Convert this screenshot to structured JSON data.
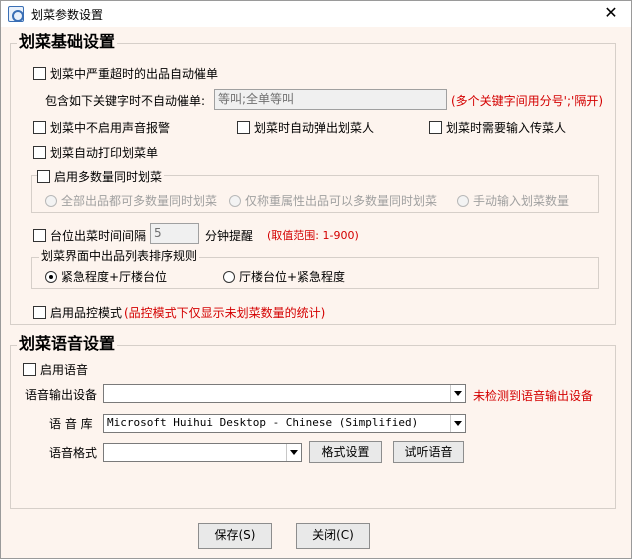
{
  "window": {
    "title": "划菜参数设置",
    "close_glyph": "✕"
  },
  "basic": {
    "title": "划菜基础设置",
    "auto_urge": "划菜中严重超时的出品自动催单",
    "keyword_label": "包含如下关键字时不自动催单:",
    "keyword_value": "等叫;全单等叫",
    "keyword_hint": "(多个关键字间用分号';'隔开)",
    "no_sound": "划菜中不启用声音报警",
    "popup_person": "划菜时自动弹出划菜人",
    "need_passer": "划菜时需要输入传菜人",
    "auto_print": "划菜自动打印划菜单",
    "multi_qty": {
      "title": "启用多数量同时划菜",
      "options": [
        "全部出品都可多数量同时划菜",
        "仅称重属性出品可以多数量同时划菜",
        "手动输入划菜数量"
      ]
    },
    "interval_label": "台位出菜时间间隔",
    "interval_value": "5",
    "interval_unit": "分钟提醒",
    "interval_hint": "(取值范围: 1-900)",
    "sort": {
      "title": "划菜界面中出品列表排序规则",
      "options": [
        "紧急程度+厅楼台位",
        "厅楼台位+紧急程度"
      ],
      "selected_index": 0
    },
    "qc_mode": "启用品控模式",
    "qc_hint": "(品控模式下仅显示未划菜数量的统计)"
  },
  "voice": {
    "title": "划菜语音设置",
    "enable": "启用语音",
    "output_label": "语音输出设备",
    "output_value": "",
    "output_hint": "未检测到语音输出设备",
    "lib_label": "语 音 库",
    "lib_value": "Microsoft Huihui Desktop - Chinese (Simplified)",
    "format_label": "语音格式",
    "format_value": "",
    "format_settings": "格式设置",
    "preview": "试听语音"
  },
  "footer": {
    "save": "保存(S)",
    "close": "关闭(C)"
  },
  "colors": {
    "accent_red": "#d40000",
    "window_bg": "#fdf4ee"
  }
}
